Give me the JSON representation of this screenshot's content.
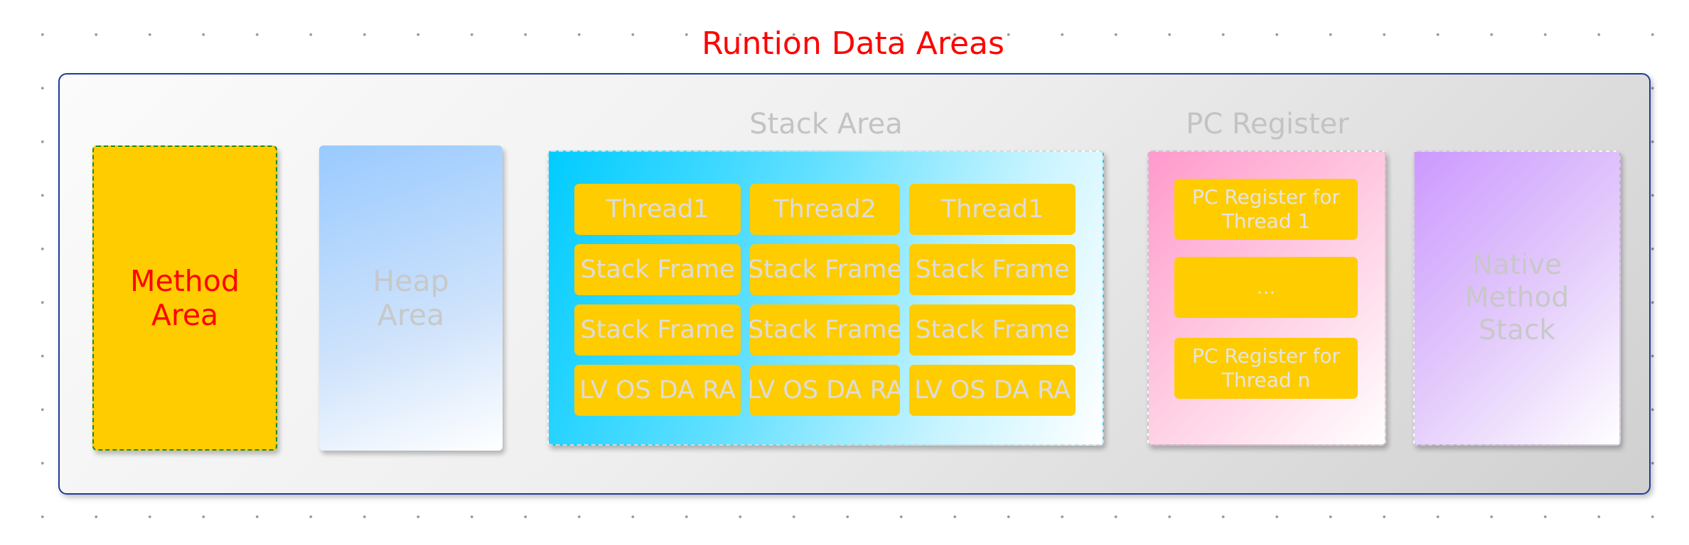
{
  "title": "Runtion Data Areas",
  "method_area": {
    "label_line1": "Method",
    "label_line2": "Area"
  },
  "heap_area": {
    "label_line1": "Heap",
    "label_line2": "Area"
  },
  "stack_area": {
    "label": "Stack Area",
    "columns": [
      {
        "thread": "Thread1",
        "frame1": "Stack Frame",
        "frame2": "Stack Frame",
        "locals": "LV OS DA RA"
      },
      {
        "thread": "Thread2",
        "frame1": "Stack Frame",
        "frame2": "Stack Frame",
        "locals": "LV OS DA RA"
      },
      {
        "thread": "Thread1",
        "frame1": "Stack Frame",
        "frame2": "Stack Frame",
        "locals": "LV OS DA RA"
      }
    ]
  },
  "pc_register": {
    "label": "PC Register",
    "items": [
      {
        "line1": "PC Register for",
        "line2": "Thread 1"
      },
      {
        "line1": "...",
        "line2": ""
      },
      {
        "line1": "PC Register for",
        "line2": "Thread n"
      }
    ]
  },
  "native_method_stack": {
    "line1": "Native",
    "line2": "Method",
    "line3": "Stack"
  },
  "colors": {
    "title": "#ff0000",
    "method_area": "#ffcc00",
    "method_area_border": "#1e8b22",
    "outer_border": "#1f3b9b",
    "heap_gradient": "#99caff",
    "stack_gradient": "#00ccff",
    "pc_gradient": "#ff99cc",
    "native_gradient": "#cc99ff"
  }
}
